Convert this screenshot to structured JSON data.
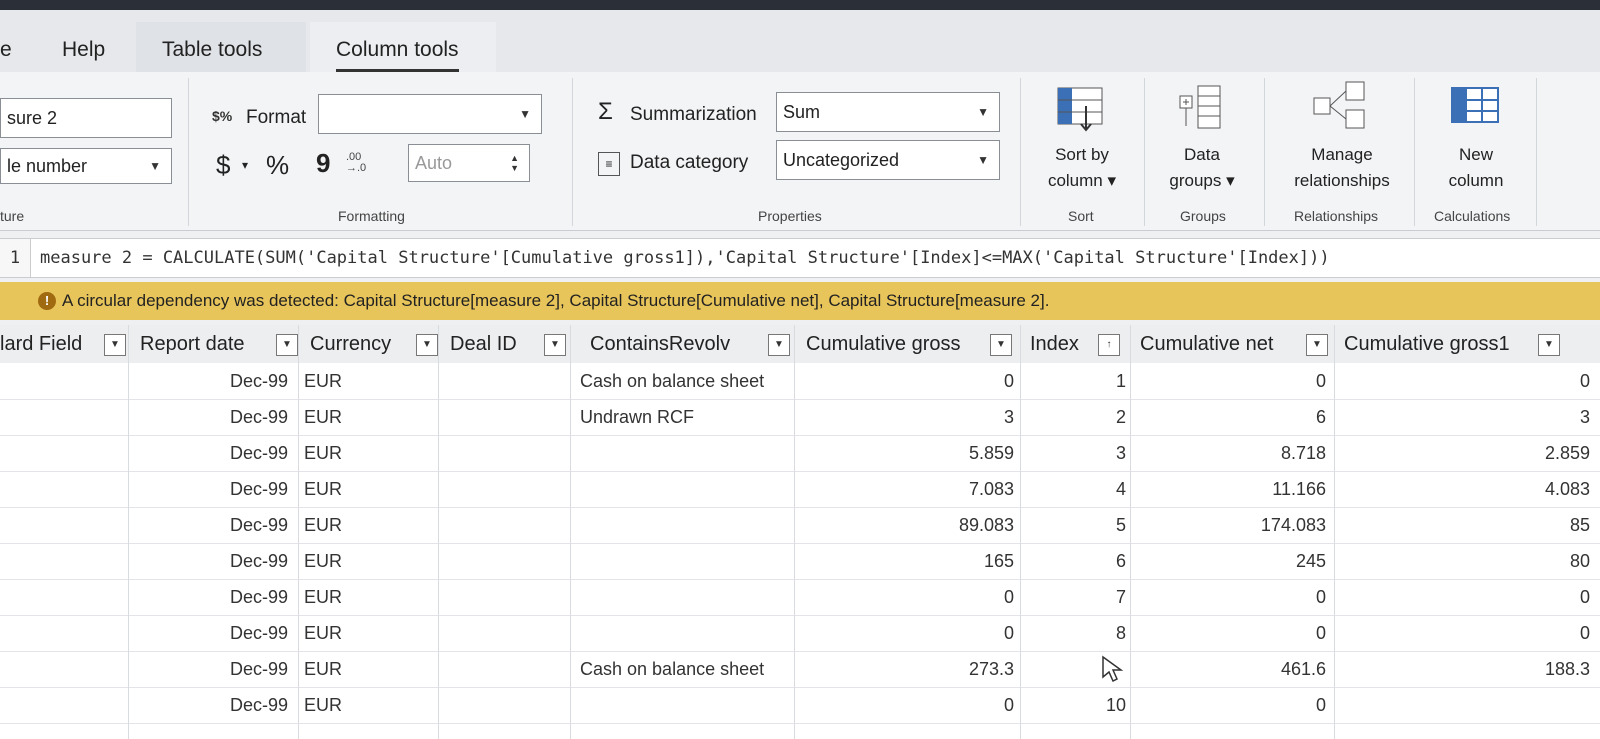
{
  "tabs": [
    {
      "label": "e"
    },
    {
      "label": "Help"
    },
    {
      "label": "Table tools"
    },
    {
      "label": "Column tools"
    }
  ],
  "ribbon": {
    "structure": {
      "name_value": "sure 2",
      "type_value": "le number",
      "group_label": "ture"
    },
    "formatting": {
      "format_label": "Format",
      "format_value": "",
      "currency_symbol": "$",
      "percent_symbol": "%",
      "comma_symbol": "9",
      "decimal_value": "Auto",
      "group_label": "Formatting"
    },
    "properties": {
      "summarization_label": "Summarization",
      "summarization_value": "Sum",
      "data_category_label": "Data category",
      "data_category_value": "Uncategorized",
      "group_label": "Properties"
    },
    "sort": {
      "button_line1": "Sort by",
      "button_line2": "column",
      "group_label": "Sort"
    },
    "groups": {
      "button_line1": "Data",
      "button_line2": "groups",
      "group_label": "Groups"
    },
    "relationships": {
      "button_line1": "Manage",
      "button_line2": "relationships",
      "group_label": "Relationships"
    },
    "calculations": {
      "button_line1": "New",
      "button_line2": "column",
      "group_label": "Calculations"
    }
  },
  "formula_bar": {
    "line_number": "1",
    "code": "measure 2 = CALCULATE(SUM('Capital Structure'[Cumulative gross1]),'Capital Structure'[Index]<=MAX('Capital Structure'[Index]))"
  },
  "warning": {
    "text": "A circular dependency was detected: Capital Structure[measure 2], Capital Structure[Cumulative net], Capital Structure[measure 2]."
  },
  "table": {
    "columns": [
      "lard Field",
      "Report date",
      "Currency",
      "Deal ID",
      "ContainsRevolv",
      "Cumulative gross",
      "Index",
      "Cumulative net",
      "Cumulative gross1"
    ],
    "rows": [
      {
        "date": "Dec-99",
        "cur": "EUR",
        "revolv": "Cash on balance sheet",
        "gross": "0",
        "index": "1",
        "net": "0",
        "gross1": "0"
      },
      {
        "date": "Dec-99",
        "cur": "EUR",
        "revolv": "Undrawn RCF",
        "gross": "3",
        "index": "2",
        "net": "6",
        "gross1": "3"
      },
      {
        "date": "Dec-99",
        "cur": "EUR",
        "revolv": "",
        "gross": "5.859",
        "index": "3",
        "net": "8.718",
        "gross1": "2.859"
      },
      {
        "date": "Dec-99",
        "cur": "EUR",
        "revolv": "",
        "gross": "7.083",
        "index": "4",
        "net": "11.166",
        "gross1": "4.083"
      },
      {
        "date": "Dec-99",
        "cur": "EUR",
        "revolv": "",
        "gross": "89.083",
        "index": "5",
        "net": "174.083",
        "gross1": "85"
      },
      {
        "date": "Dec-99",
        "cur": "EUR",
        "revolv": "",
        "gross": "165",
        "index": "6",
        "net": "245",
        "gross1": "80"
      },
      {
        "date": "Dec-99",
        "cur": "EUR",
        "revolv": "",
        "gross": "0",
        "index": "7",
        "net": "0",
        "gross1": "0"
      },
      {
        "date": "Dec-99",
        "cur": "EUR",
        "revolv": "",
        "gross": "0",
        "index": "8",
        "net": "0",
        "gross1": "0"
      },
      {
        "date": "Dec-99",
        "cur": "EUR",
        "revolv": "Cash on balance sheet",
        "gross": "273.3",
        "index": "",
        "net": "461.6",
        "gross1": "188.3"
      },
      {
        "date": "Dec-99",
        "cur": "EUR",
        "revolv": "",
        "gross": "0",
        "index": "10",
        "net": "0",
        "gross1": ""
      }
    ]
  }
}
